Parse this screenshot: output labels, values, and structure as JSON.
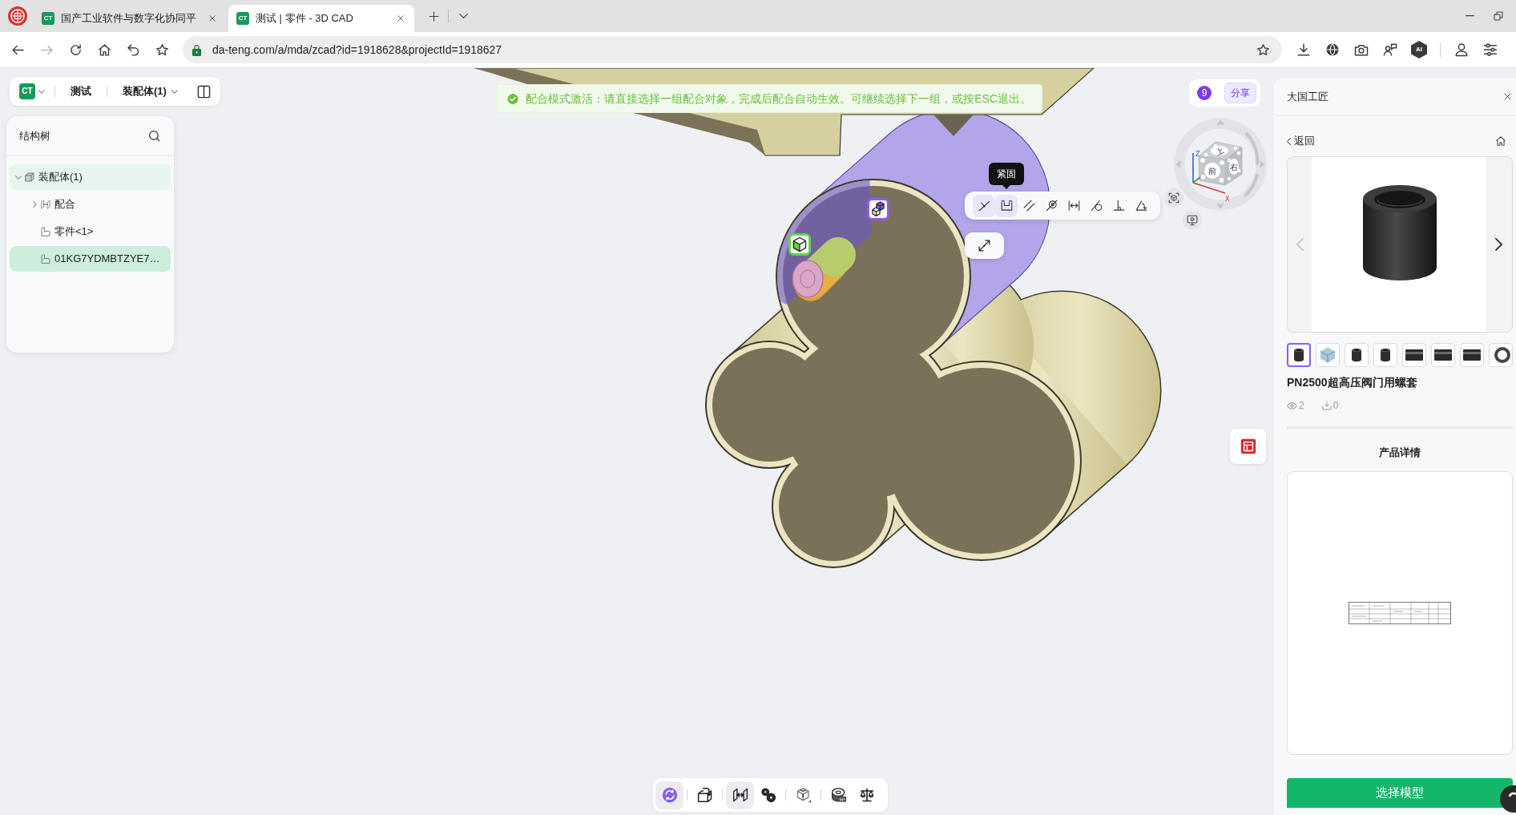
{
  "browser": {
    "tabs": [
      {
        "logo": "CT",
        "title": "国产工业软件与数字化协同平",
        "selected": false
      },
      {
        "logo": "CT",
        "title": "测试 | 零件 - 3D CAD",
        "selected": true
      }
    ],
    "nav_buttons": [
      {
        "kind": "back",
        "disabled": false
      },
      {
        "kind": "forward",
        "disabled": true
      },
      {
        "kind": "reload",
        "disabled": false
      },
      {
        "kind": "home",
        "disabled": false
      },
      {
        "kind": "undo",
        "disabled": false
      },
      {
        "kind": "star",
        "disabled": false
      }
    ],
    "url": "da-teng.com/a/mda/zcad?id=1918628&projectId=1918627",
    "extensions": [
      {
        "kind": "download"
      },
      {
        "kind": "globe"
      },
      {
        "kind": "camera"
      },
      {
        "kind": "people"
      },
      {
        "kind": "ai",
        "label": "AI"
      }
    ],
    "menu_buttons": [
      {
        "kind": "profile"
      },
      {
        "kind": "sliders"
      }
    ]
  },
  "app_toolbar": {
    "logo": "CT",
    "project": "测试",
    "document": "装配体(1)"
  },
  "structure_tree": {
    "title": "结构树",
    "nodes": [
      {
        "label": "装配体(1)",
        "kind": "assembly",
        "expanded": true,
        "highlighted": true,
        "selected": false,
        "children": [
          {
            "label": "配合",
            "kind": "mates",
            "expanded": false,
            "highlighted": false,
            "selected": false
          },
          {
            "label": "零件<1>",
            "kind": "part",
            "highlighted": false,
            "selected": false
          },
          {
            "label": "01KG7YDMBTZYE7…",
            "kind": "part",
            "highlighted": false,
            "selected": true
          }
        ]
      }
    ]
  },
  "notification": {
    "kind": "success",
    "message": "配合模式激活：请直接选择一组配合对象，完成后配合自动生效。可继续选择下一组，或按ESC退出。"
  },
  "selection_markers": [
    {
      "kind": "two-cubes",
      "color": "#8b5cf6"
    },
    {
      "kind": "cube",
      "color": "#5fd34a"
    }
  ],
  "mate_toolbar": {
    "tools": [
      {
        "kind": "coincident",
        "highlighted": true
      },
      {
        "kind": "fasten",
        "highlighted": true,
        "tooltip": "紧固"
      },
      {
        "kind": "parallel",
        "highlighted": false
      },
      {
        "kind": "concentric",
        "highlighted": false
      },
      {
        "kind": "distance",
        "highlighted": false
      },
      {
        "kind": "tangent",
        "highlighted": false
      },
      {
        "kind": "perpendicular",
        "highlighted": false
      },
      {
        "kind": "angle",
        "highlighted": false
      }
    ]
  },
  "view_cube": {
    "faces": [
      "上",
      "前",
      "右"
    ],
    "axes": [
      "Z",
      "X"
    ]
  },
  "share": {
    "count": "9",
    "label": "分享"
  },
  "bottom_toolbar": {
    "groups": [
      {
        "tools": [
          {
            "kind": "rotate",
            "selected": true
          }
        ]
      },
      {
        "tools": [
          {
            "kind": "insert",
            "selected": false
          }
        ]
      },
      {
        "tools": [
          {
            "kind": "mate",
            "selected": true
          },
          {
            "kind": "gears",
            "selected": false
          }
        ]
      },
      {
        "tools": [
          {
            "kind": "views",
            "selected": false
          }
        ]
      },
      {
        "tools": [
          {
            "kind": "measure",
            "selected": false
          },
          {
            "kind": "mass",
            "selected": false
          }
        ]
      }
    ]
  },
  "side_panel": {
    "title": "大国工匠",
    "back": "返回",
    "carousel": {
      "prev_disabled": true,
      "next_disabled": false
    },
    "thumbnails": [
      {
        "kind": "cylinder",
        "selected": true
      },
      {
        "kind": "part",
        "selected": false
      },
      {
        "kind": "cylinder",
        "selected": false
      },
      {
        "kind": "cylinder",
        "selected": false
      },
      {
        "kind": "band",
        "selected": false
      },
      {
        "kind": "band",
        "selected": false
      },
      {
        "kind": "band",
        "selected": false
      },
      {
        "kind": "ring",
        "selected": false
      }
    ],
    "product_name": "PN2500超高压阀门用螺套",
    "views": "2",
    "downloads": "0",
    "details_title": "产品详情",
    "action": "选择模型"
  }
}
